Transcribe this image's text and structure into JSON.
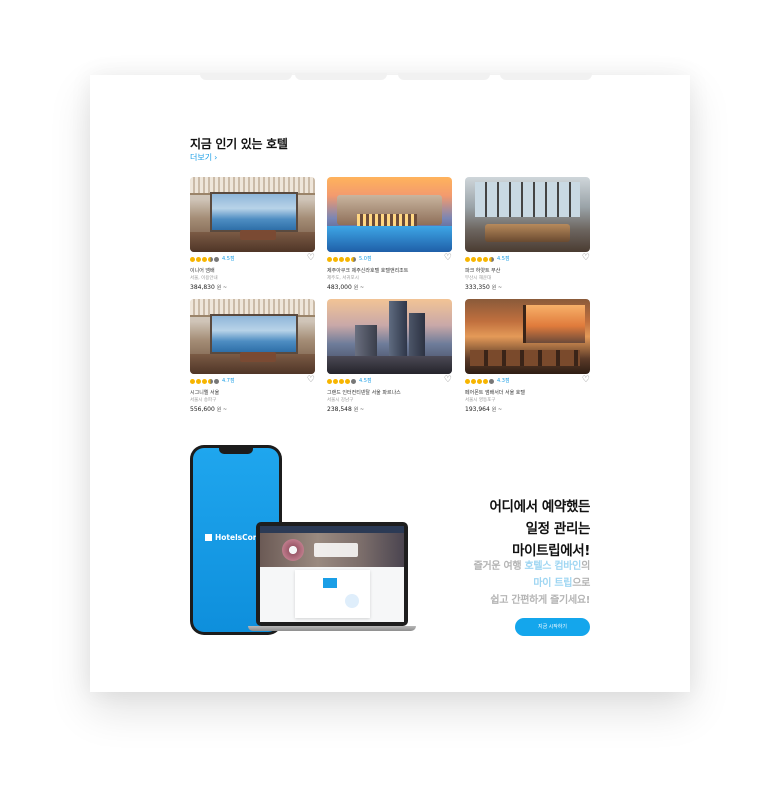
{
  "section": {
    "title": "지금 인기 있는 호텔",
    "more_label": "더보기",
    "more_icon": "chevron-right-icon"
  },
  "hotels": [
    {
      "rating": "4.5점",
      "stars": 4.5,
      "name": "이니어 앰배",
      "location": "서울, 이용안내",
      "price": "384,830",
      "unit": "원 ~"
    },
    {
      "rating": "5.0점",
      "stars": 4.5,
      "name": "제주아쿠크 제주신라호텔 호텔앤리조트",
      "location": "제주도, 서귀포시",
      "price": "483,000",
      "unit": "원 ~"
    },
    {
      "rating": "4.5점",
      "stars": 4.5,
      "name": "파크 하얏트 부산",
      "location": "부산시 해운대",
      "price": "333,350",
      "unit": "원 ~"
    },
    {
      "rating": "4.7점",
      "stars": 3.5,
      "name": "시그니엘 서울",
      "location": "서울시 송파구",
      "price": "556,600",
      "unit": "원 ~"
    },
    {
      "rating": "4.5점",
      "stars": 4.0,
      "name": "그랜드 인터컨티넨탈 서울 파르나스",
      "location": "서울시 강남구",
      "price": "238,548",
      "unit": "원 ~"
    },
    {
      "rating": "4.3점",
      "stars": 4.0,
      "name": "페어몬트 앰배서더 서울 호텔",
      "location": "서울시 영등포구",
      "price": "193,964",
      "unit": "원 ~"
    }
  ],
  "promo": {
    "title_1": "어디에서 예약했든",
    "title_2": "일정 관리는",
    "title_3": "마이트립에서!",
    "sub_1a": "즐거운 여행 ",
    "sub_1b": "호텔스 컴바인",
    "sub_1c": "의",
    "sub_2a": "마이 트립",
    "sub_2b": "으로",
    "sub_3": "쉽고 간편하게 즐기세요!",
    "cta": "지금 시작하기",
    "phone_brand": "HotelsComb"
  },
  "colors": {
    "accent": "#14a6ec",
    "star": "#f7b500"
  }
}
